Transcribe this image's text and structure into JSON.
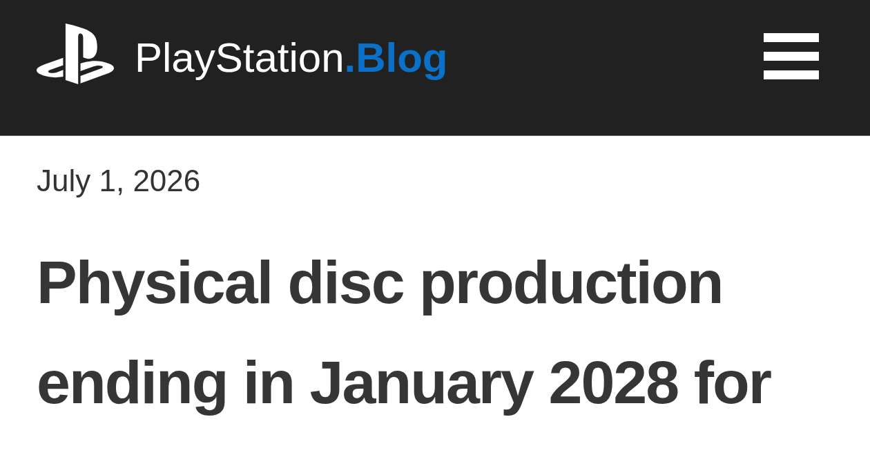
{
  "header": {
    "site_title": "PlayStation**.Blog**"
  },
  "article": {
    "date": "July 1, 2026",
    "headline": "Physical disc production ending in January 2028 for"
  }
}
